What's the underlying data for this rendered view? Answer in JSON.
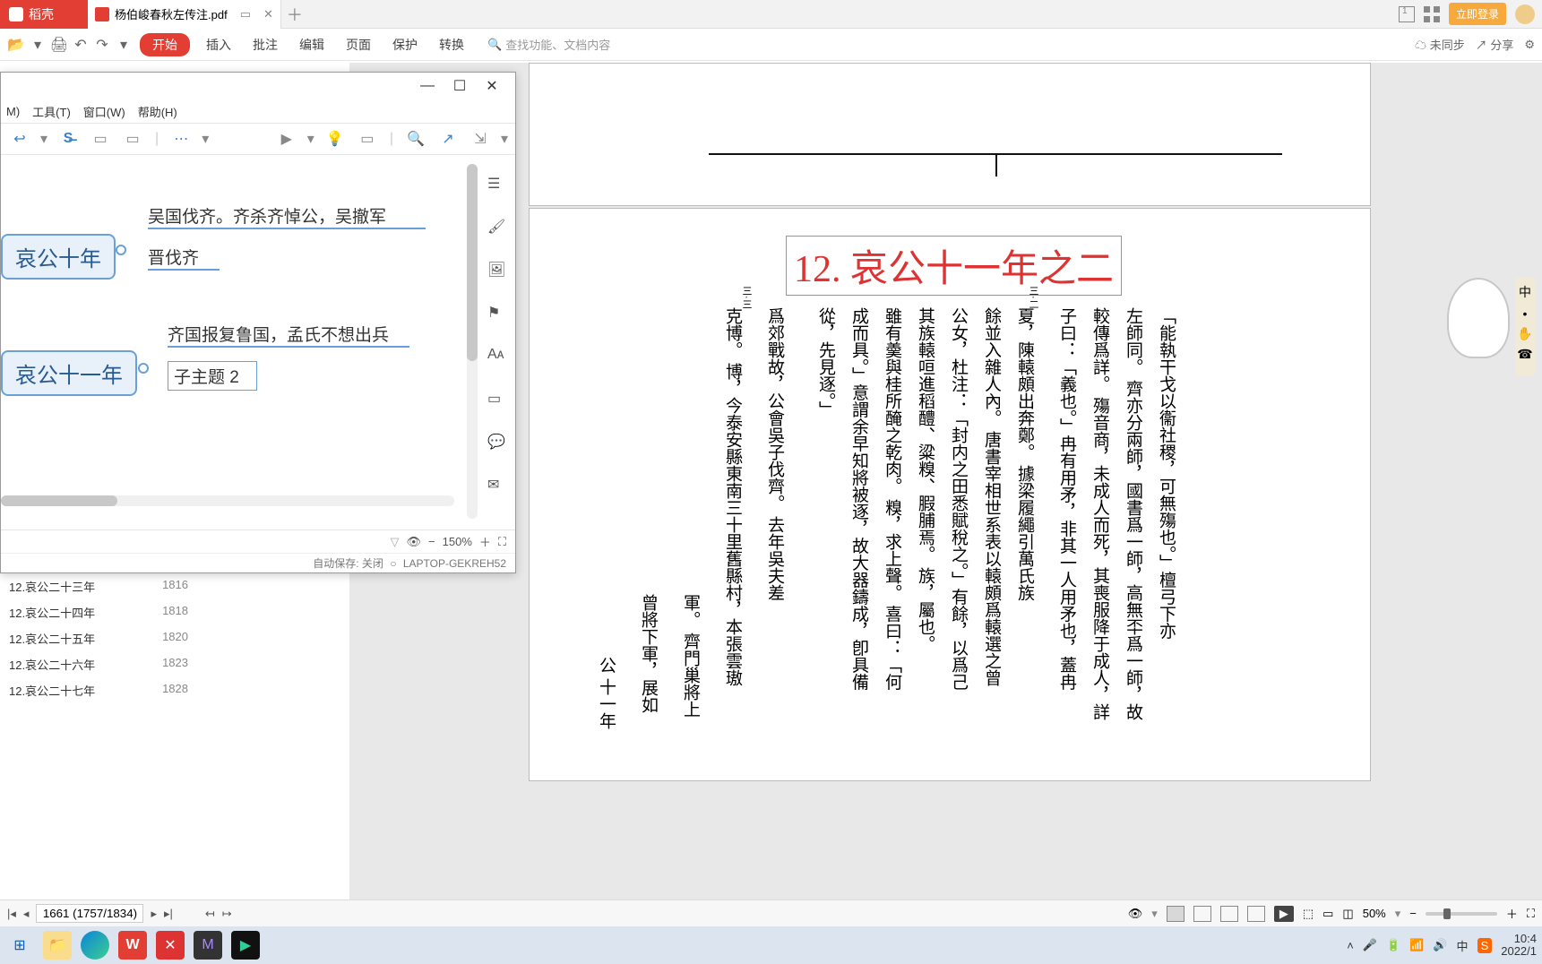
{
  "tabbar": {
    "home": "稻壳",
    "doc": "杨伯峻春秋左传注.pdf"
  },
  "toolbar": {
    "start": "开始",
    "insert": "插入",
    "review": "批注",
    "edit": "编辑",
    "page": "页面",
    "protect": "保护",
    "convert": "转换",
    "search_ph": "查找功能、文档内容",
    "unsync": "未同步",
    "share": "分享",
    "login": "立即登录"
  },
  "mind": {
    "menu": {
      "m": "M)",
      "tools": "工具(T)",
      "window": "窗口(W)",
      "help": "帮助(H)"
    },
    "nodes": {
      "n10": "哀公十年",
      "n10a": "吴国伐齐。齐杀齐悼公，吴撤军",
      "n10b": "晋伐齐",
      "n11": "哀公十一年",
      "n11a": "齐国报复鲁国，孟氏不想出兵",
      "n11b": "子主题 2"
    },
    "zoom": "150%",
    "autosave": "自动保存: 关闭",
    "computer": "LAPTOP-GEKREH52"
  },
  "outline": [
    {
      "t": "12.哀公二十三年",
      "p": "1816"
    },
    {
      "t": "12.哀公二十四年",
      "p": "1818"
    },
    {
      "t": "12.哀公二十五年",
      "p": "1820"
    },
    {
      "t": "12.哀公二十六年",
      "p": "1823"
    },
    {
      "t": "12.哀公二十七年",
      "p": "1828"
    }
  ],
  "pdf": {
    "chapter": "12. 哀公十一年之二",
    "cols": [
      "「能執干戈以衞社稷，可無殤也。」檀弓下亦",
      "左師同。    齊亦分兩師，國書爲一師，高無㔻爲一師，故",
      "較傳爲詳。    殤音商，未成人而死，其喪服降于成人，詳",
      "子曰：「義也。」冉有用矛，非其一人用矛也，蓋冉",
      "夏，陳轅頗出奔鄭。    據梁履繩引萬氏族",
      "餘並入雜人內。    唐書宰相世系表以轅頗爲轅選之曾",
      "公女，杜注：「封内之田悉賦稅之。」有餘，以爲己",
      "其族轅咺進稻醴、粱糗、腵脯焉。    族，屬也。",
      "雖有羮與桂所醃之乾肉。    糗，求上聲。    喜曰：「何",
      "成而具。」意謂余早知將被逐，故大器鑄成，卽具備",
      "從，先見逐。」",
      "    爲郊戰故，公會吳子伐齊。    去年吳夫差",
      "克博。    博，今泰安縣東南三十里舊縣村，本張雲璈",
      "軍。    齊門巢將上",
      "曾將下軍，展如",
      "公    十一年"
    ],
    "mark1": "三·二",
    "mark2": "三·三"
  },
  "pager": {
    "pageinfo": "1661 (1757/1834)",
    "zoom": "50%"
  },
  "taskbar": {
    "ime": "中",
    "sogou": "S",
    "time": "10:4",
    "date": "2022/1"
  },
  "bunny": {
    "a": "中",
    "b": "•",
    "c": "✋",
    "d": "☎"
  }
}
